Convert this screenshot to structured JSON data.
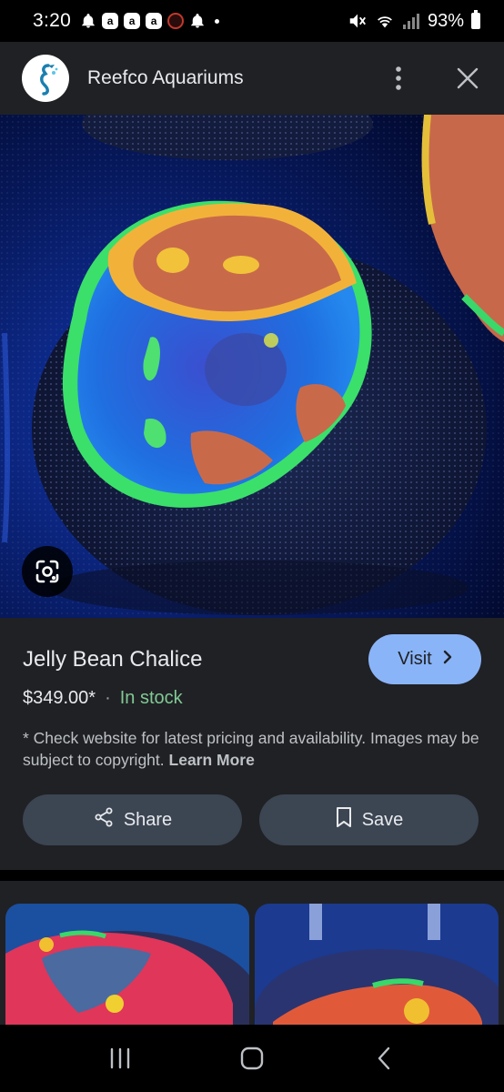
{
  "status_bar": {
    "time": "3:20",
    "battery": "93%",
    "notification_icons": [
      "bell-icon",
      "app-a-icon",
      "app-a-icon",
      "app-a-icon",
      "clownfish-icon",
      "bell-icon",
      "dot-icon"
    ],
    "system_icons": [
      "mute-icon",
      "wifi-icon",
      "signal-icon",
      "battery-icon"
    ]
  },
  "header": {
    "site_name": "Reefco Aquariums",
    "logo_icon": "seahorse-logo-icon",
    "more_icon": "more-vertical-icon",
    "close_icon": "close-icon"
  },
  "hero": {
    "lens_icon": "google-lens-icon"
  },
  "product": {
    "title": "Jelly Bean Chalice",
    "price": "$349.00*",
    "separator": "·",
    "availability": "In stock",
    "disclaimer": "* Check website for latest pricing and availability. Images may be subject to copyright.",
    "learn_more": "Learn More",
    "visit_label": "Visit",
    "share_label": "Share",
    "save_label": "Save"
  },
  "colors": {
    "accent": "#8ab4f8",
    "in_stock": "#81c995",
    "panel": "#202124",
    "button": "#3c4552"
  },
  "nav_bar": {
    "icons": [
      "recent-apps-icon",
      "home-icon",
      "back-icon"
    ]
  }
}
